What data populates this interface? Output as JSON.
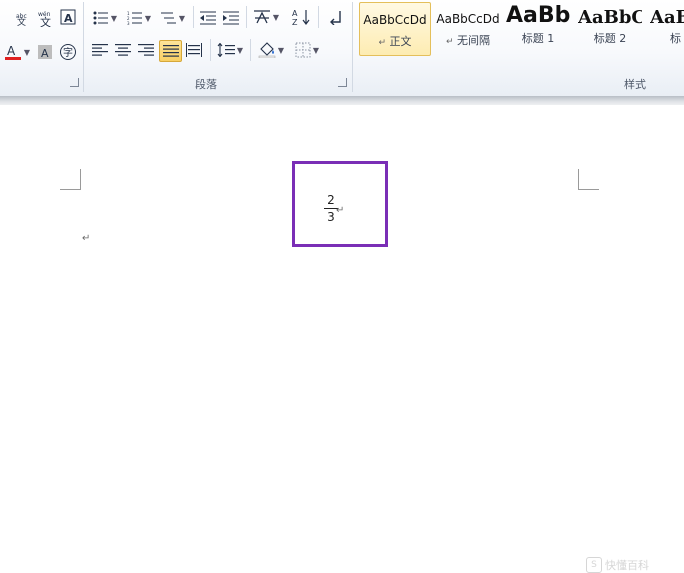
{
  "ribbon": {
    "paragraph_group_label": "段落",
    "styles_group_label": "样式"
  },
  "styles": [
    {
      "sample": "AaBbCcDd",
      "name": "正文",
      "mark": "↵"
    },
    {
      "sample": "AaBbCcDd",
      "name": "无间隔",
      "mark": "↵"
    },
    {
      "sample": "AaBb",
      "name": "标题 1"
    },
    {
      "sample": "AaBbC",
      "name": "标题 2"
    },
    {
      "sample": "AaB",
      "name": "标"
    }
  ],
  "colors": {
    "accent_selected": "#fde59a",
    "highlight_box": "#7a2eb6",
    "font_color_bar": "#e02020"
  },
  "document": {
    "fraction_numerator": "2",
    "fraction_denominator": "3",
    "paragraph_mark": "↵"
  },
  "watermark": {
    "text": "快懂百科"
  }
}
